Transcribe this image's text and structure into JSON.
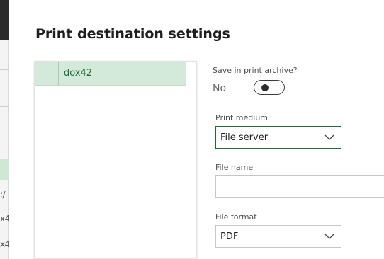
{
  "background": {
    "fragments": [
      ":/",
      "x4",
      "x4"
    ]
  },
  "dialog": {
    "title": "Print destination settings"
  },
  "destinations": [
    {
      "label": "dox42",
      "selected": true
    }
  ],
  "archive": {
    "label": "Save in print archive?",
    "value": "No",
    "toggle_on": false
  },
  "print_medium": {
    "label": "Print medium",
    "value": "File server"
  },
  "file_name": {
    "label": "File name",
    "value": ""
  },
  "file_format": {
    "label": "File format",
    "value": "PDF"
  },
  "colors": {
    "accent": "#1f6b38",
    "selected_row": "#d3e9d9"
  },
  "icons": {
    "medium_dropdown": "chevron-down-icon",
    "format_dropdown": "chevron-down-icon"
  }
}
